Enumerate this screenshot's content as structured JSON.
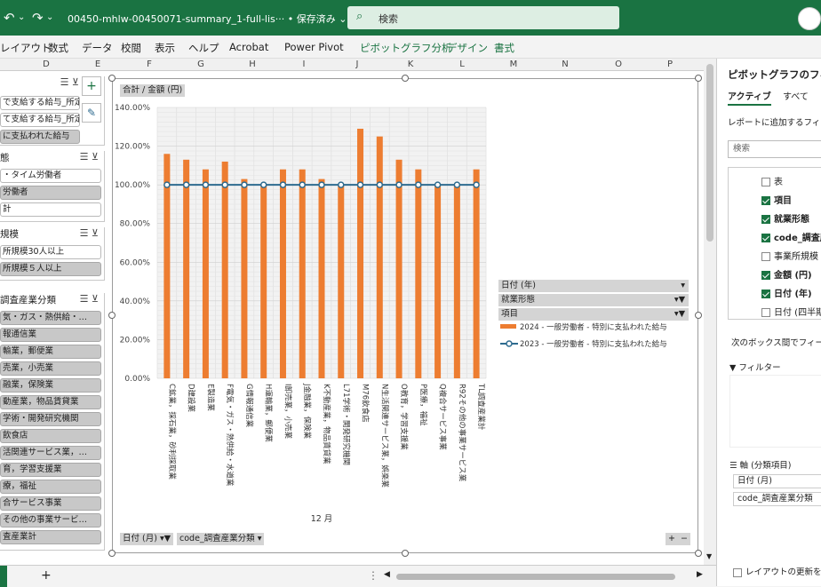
{
  "titlebar": {
    "filename": "00450-mhlw-00450071-summary_1-full-lis···  •  保存済み ⌄",
    "search_placeholder": "検索"
  },
  "menu": [
    "レイアウト",
    "数式",
    "データ",
    "校閲",
    "表示",
    "ヘルプ",
    "Acrobat",
    "Power Pivot",
    "ピボットグラフ分析",
    "デザイン",
    "書式"
  ],
  "columns": [
    "D",
    "E",
    "F",
    "G",
    "H",
    "I",
    "J",
    "K",
    "L",
    "M",
    "N",
    "O",
    "P"
  ],
  "slicers": [
    {
      "title": "",
      "items": [
        {
          "label": "で支給する給与_所定外",
          "sel": false
        },
        {
          "label": "て支給する給与_所定内",
          "sel": false
        },
        {
          "label": "に支払われた給与",
          "sel": true
        }
      ]
    },
    {
      "title": "態",
      "items": [
        {
          "label": "・タイム労働者",
          "sel": false
        },
        {
          "label": "労働者",
          "sel": true
        },
        {
          "label": "計",
          "sel": false
        }
      ]
    },
    {
      "title": "規模",
      "items": [
        {
          "label": "所規模30人以上",
          "sel": false
        },
        {
          "label": "所規模５人以上",
          "sel": true
        }
      ]
    },
    {
      "title": "調査産業分類",
      "items": [
        {
          "label": "気・ガス・熱供給・…",
          "sel": true
        },
        {
          "label": "報通信業",
          "sel": true
        },
        {
          "label": "輸業，郵便業",
          "sel": true
        },
        {
          "label": "売業，小売業",
          "sel": true
        },
        {
          "label": "融業，保険業",
          "sel": true
        },
        {
          "label": "動産業，物品賃貸業",
          "sel": true
        },
        {
          "label": "学術・開発研究機関",
          "sel": true
        },
        {
          "label": "飲食店",
          "sel": true
        },
        {
          "label": "活関連サービス業，…",
          "sel": true
        },
        {
          "label": "育，学習支援業",
          "sel": true
        },
        {
          "label": "療，福祉",
          "sel": true
        },
        {
          "label": "合サービス事業",
          "sel": true
        },
        {
          "label": "その他の事業サービ…",
          "sel": true
        },
        {
          "label": "査産業計",
          "sel": true
        }
      ]
    }
  ],
  "chart": {
    "field_value": "合計 / 金額 (円)",
    "x_group_label": "12 月",
    "legend_fields": [
      "日付 (年)",
      "就業形態",
      "項目"
    ],
    "axis_buttons": [
      "日付 (月)",
      "code_調査産業分類"
    ]
  },
  "chart_data": {
    "type": "bar",
    "ylim": [
      0,
      140
    ],
    "yticks": [
      "0.00%",
      "20.00%",
      "40.00%",
      "60.00%",
      "80.00%",
      "100.00%",
      "120.00%",
      "140.00%"
    ],
    "categories": [
      "C鉱業，採石業，砂利採取業",
      "D建設業",
      "E製造業",
      "F電気・ガス・熱供給・水道業",
      "G情報通信業",
      "H運輸業，郵便業",
      "I卸売業，小売業",
      "J金融業，保険業",
      "K不動産業，物品賃貸業",
      "L71学術・開発研究機関",
      "M76飲食店",
      "N生活関連サービス業，娯楽業",
      "O教育，学習支援業",
      "P医療，福祉",
      "Q複合サービス事業",
      "R92その他の事業サービス業",
      "TL調査産業計"
    ],
    "series": [
      {
        "name": "2024 - 一般労働者 - 特別に支払われた給与",
        "type": "bar",
        "color": "#ed7d31",
        "values": [
          116,
          113,
          108,
          112,
          103,
          100,
          108,
          108,
          103,
          100,
          129,
          125,
          113,
          108,
          100,
          100,
          108
        ]
      },
      {
        "name": "2023 - 一般労働者 - 特別に支払われた給与",
        "type": "line",
        "color": "#2e6b8f",
        "values": [
          100,
          100,
          100,
          100,
          100,
          100,
          100,
          100,
          100,
          100,
          100,
          100,
          100,
          100,
          100,
          100,
          100
        ]
      }
    ]
  },
  "panel": {
    "title": "ピボットグラフのフィー",
    "tabs": [
      "アクティブ",
      "すべて"
    ],
    "instruction": "レポートに追加するフィール",
    "search_placeholder": "検索",
    "fields": [
      {
        "label": "表",
        "checked": false,
        "bold": false
      },
      {
        "label": "項目",
        "checked": true,
        "bold": true
      },
      {
        "label": "就業形態",
        "checked": true,
        "bold": true
      },
      {
        "label": "code_調査産",
        "checked": true,
        "bold": true
      },
      {
        "label": "事業所規模",
        "checked": false,
        "bold": false
      },
      {
        "label": "金額 (円)",
        "checked": true,
        "bold": true
      },
      {
        "label": "日付 (年)",
        "checked": true,
        "bold": true
      },
      {
        "label": "日付 (四半期",
        "checked": false,
        "bold": false
      }
    ],
    "drag_instruction": "次のボックス間でフィールド",
    "filter_label": "フィルター",
    "axis_label": "軸 (分類項目)",
    "axis_items": [
      "日付 (月)",
      "code_調査産業分類"
    ],
    "defer_label": "レイアウトの更新を保"
  }
}
